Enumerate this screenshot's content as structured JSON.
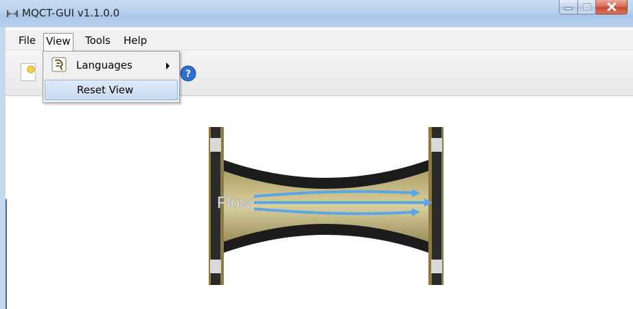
{
  "window": {
    "title": "MQCT-GUI v1.1.0.0"
  },
  "menubar": {
    "items": [
      "File",
      "View",
      "Tools",
      "Help"
    ]
  },
  "view_menu": {
    "items": [
      {
        "label": "Languages",
        "submenu": true,
        "icon": "language-icon"
      },
      {
        "label": "Reset View",
        "highlighted": true
      }
    ]
  },
  "toolbar": {
    "icons": [
      "new-file-icon",
      "help-icon"
    ]
  },
  "diagram": {
    "label": "Flow"
  }
}
